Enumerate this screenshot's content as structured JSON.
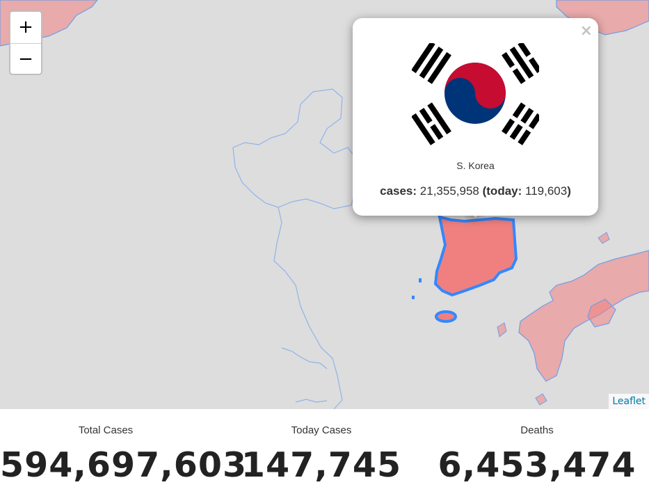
{
  "map": {
    "zoom_in_label": "+",
    "zoom_out_label": "−",
    "attribution": "Leaflet",
    "colors": {
      "background": "#dddddd",
      "country_fill": "#f08080",
      "highlight_border": "#3388ff",
      "coastline": "#8fb3ea"
    }
  },
  "popup": {
    "close_label": "×",
    "country": "S. Korea",
    "cases_label": "cases:",
    "cases_value": "21,355,958",
    "today_open": "(today:",
    "today_value": "119,603",
    "today_close": ")",
    "flag_icon": "south-korea-flag-icon"
  },
  "stats": [
    {
      "label": "Total Cases",
      "value": "594,697,603"
    },
    {
      "label": "Today Cases",
      "value": "147,745"
    },
    {
      "label": "Deaths",
      "value": "6,453,474"
    }
  ]
}
